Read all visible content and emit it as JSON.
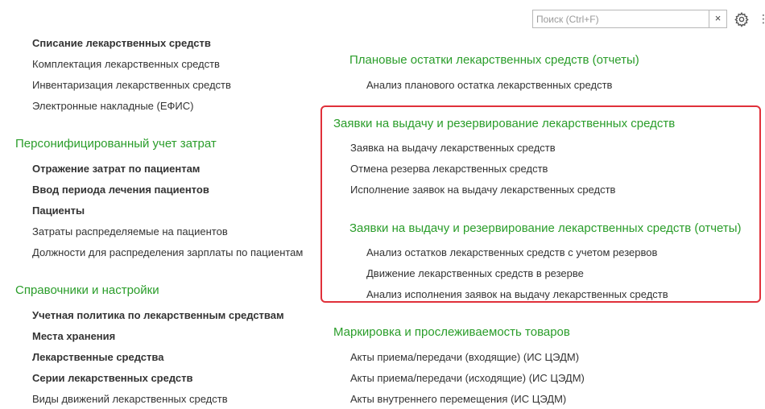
{
  "search": {
    "placeholder": "Поиск (Ctrl+F)",
    "clear_label": "×"
  },
  "icons": {
    "settings": "gear-icon",
    "more": "more-icon"
  },
  "colors": {
    "group_title": "#2a9d2a",
    "highlight_border": "#e0303a",
    "text": "#333333"
  },
  "left_column": {
    "top_items": [
      {
        "label": "Списание лекарственных средств",
        "bold": true
      },
      {
        "label": "Комплектация лекарственных средств",
        "bold": false
      },
      {
        "label": "Инвентаризация лекарственных средств",
        "bold": false
      },
      {
        "label": "Электронные накладные (ЕФИС)",
        "bold": false
      }
    ],
    "groups": [
      {
        "title": "Персонифицированный учет затрат",
        "items": [
          {
            "label": "Отражение затрат по пациентам",
            "bold": true
          },
          {
            "label": "Ввод периода лечения пациентов",
            "bold": true
          },
          {
            "label": "Пациенты",
            "bold": true
          },
          {
            "label": "Затраты распределяемые на пациентов",
            "bold": false
          },
          {
            "label": "Должности для распределения зарплаты по пациентам",
            "bold": false
          }
        ]
      },
      {
        "title": "Справочники и настройки",
        "items": [
          {
            "label": "Учетная политика по лекарственным средствам",
            "bold": true
          },
          {
            "label": "Места хранения",
            "bold": true
          },
          {
            "label": "Лекарственные средства",
            "bold": true
          },
          {
            "label": "Серии лекарственных средств",
            "bold": true
          },
          {
            "label": "Виды движений лекарственных средств",
            "bold": false
          }
        ]
      }
    ]
  },
  "right_column": {
    "groups": [
      {
        "title": "Плановые остатки лекарственных средств (отчеты)",
        "items": [
          {
            "label": "Анализ планового остатка лекарственных средств"
          }
        ]
      },
      {
        "title": "Заявки на выдачу и  резервирование лекарственных средств",
        "items": [
          {
            "label": "Заявка на выдачу лекарственных средств"
          },
          {
            "label": "Отмена резерва лекарственных средств"
          },
          {
            "label": "Исполнение заявок на выдачу лекарственных средств"
          }
        ]
      },
      {
        "title": "Заявки на выдачу и  резервирование лекарственных средств (отчеты)",
        "items": [
          {
            "label": "Анализ остатков лекарственных средств с учетом резервов"
          },
          {
            "label": "Движение лекарственных средств в резерве"
          },
          {
            "label": "Анализ исполнения заявок на выдачу лекарственных средств"
          }
        ]
      },
      {
        "title": "Маркировка и прослеживаемость товаров",
        "items": [
          {
            "label": "Акты приема/передачи (входящие) (ИС ЦЭДМ)"
          },
          {
            "label": "Акты приема/передачи (исходящие) (ИС ЦЭДМ)"
          },
          {
            "label": "Акты внутреннего перемещения (ИС ЦЭДМ)"
          }
        ]
      }
    ]
  }
}
